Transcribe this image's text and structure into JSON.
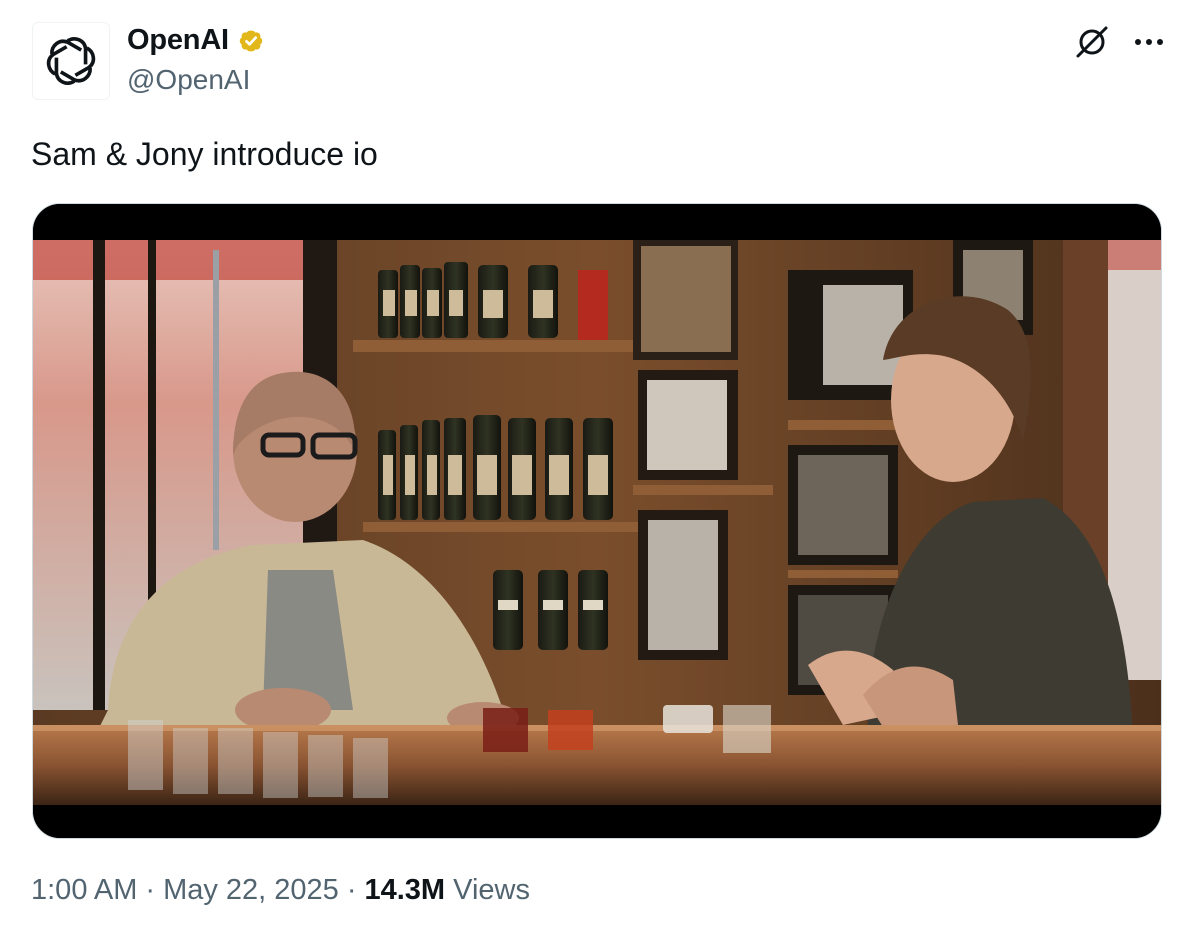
{
  "author": {
    "display_name": "OpenAI",
    "handle": "@OpenAI",
    "verified": true,
    "verified_color": "#e2b719",
    "avatar_icon": "openai-logo-icon"
  },
  "actions": {
    "grok_icon": "grok-icon",
    "more_icon": "more-horizontal-icon"
  },
  "tweet": {
    "text": "Sam & Jony introduce io"
  },
  "media": {
    "type": "video-still",
    "alt": "Sam & Jony introduce io"
  },
  "meta": {
    "time": "1:00 AM",
    "separator": "·",
    "date": "May 22, 2025",
    "views_count": "14.3M",
    "views_label": "Views"
  }
}
